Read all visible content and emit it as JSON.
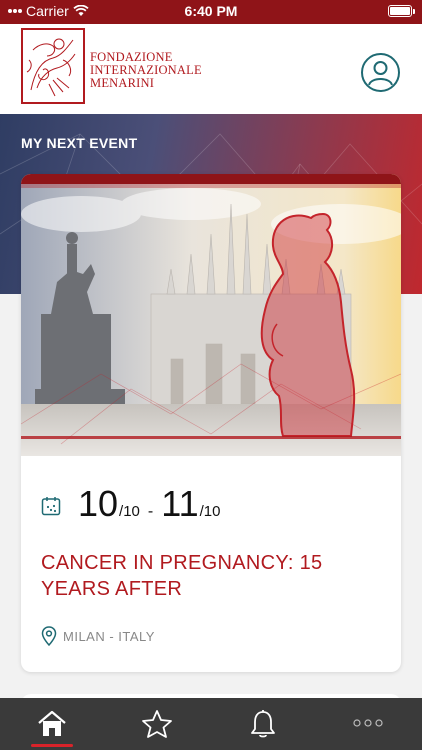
{
  "status_bar": {
    "carrier": "Carrier",
    "time": "6:40 PM"
  },
  "header": {
    "logo_lines": [
      "FONDAZIONE",
      "INTERNAZIONALE",
      "MENARINI"
    ],
    "profile_icon": "user-circle-icon"
  },
  "section": {
    "title": "MY NEXT EVENT"
  },
  "event": {
    "start_day": "10",
    "start_month": "/10",
    "separator": "-",
    "end_day": "11",
    "end_month": "/10",
    "title": "CANCER IN PREGNANCY: 15 YEARS AFTER",
    "location": "MILAN - ITALY"
  },
  "tabbar": {
    "tabs": [
      {
        "icon": "home-icon",
        "active": true
      },
      {
        "icon": "star-icon",
        "active": false
      },
      {
        "icon": "bell-icon",
        "active": false
      },
      {
        "icon": "more-icon",
        "active": false
      }
    ]
  },
  "colors": {
    "brand_red": "#b11a1f",
    "status_red": "#8f1418",
    "teal": "#1f6a73",
    "tabbar_bg": "#3a3a3a",
    "active_tab": "#d9232a"
  }
}
